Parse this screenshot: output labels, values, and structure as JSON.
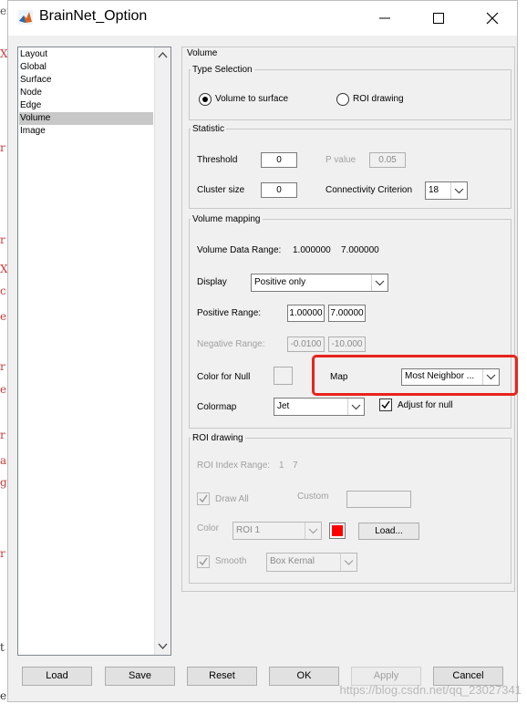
{
  "window": {
    "title": "BrainNet_Option"
  },
  "colors": {
    "highlight": "#e8241c",
    "roi_color": "#ff0000"
  },
  "background_fragments": [
    "ef",
    "X",
    "r",
    "r",
    "X",
    "c",
    "e",
    "r",
    "e",
    "r",
    "a",
    "g",
    "r",
    "t",
    "e."
  ],
  "sidebar": {
    "items": [
      "Layout",
      "Global",
      "Surface",
      "Node",
      "Edge",
      "Volume",
      "Image"
    ],
    "selected": "Volume"
  },
  "volume_panel": {
    "title": "Volume",
    "type_selection": {
      "title": "Type Selection",
      "options": [
        {
          "label": "Volume to surface",
          "selected": true
        },
        {
          "label": "ROI drawing",
          "selected": false
        }
      ]
    },
    "statistic": {
      "title": "Statistic",
      "threshold_label": "Threshold",
      "threshold_value": "0",
      "pvalue_label": "P value",
      "pvalue_value": "0.05",
      "cluster_label": "Cluster size",
      "cluster_value": "0",
      "connectivity_label": "Connectivity Criterion",
      "connectivity_value": "18"
    },
    "volume_mapping": {
      "title": "Volume mapping",
      "data_range_label": "Volume Data Range:",
      "data_range_min": "1.000000",
      "data_range_max": "7.000000",
      "display_label": "Display",
      "display_value": "Positive only",
      "positive_label": "Positive Range:",
      "positive_min": "1.00000",
      "positive_max": "7.00000",
      "negative_label": "Negative Range:",
      "negative_min": "-0.0100",
      "negative_max": "-10.000",
      "color_null_label": "Color for Null",
      "map_label": "Map",
      "map_value": "Most Neighbor ...",
      "colormap_label": "Colormap",
      "colormap_value": "Jet",
      "adjust_null_label": "Adjust for null",
      "adjust_null_checked": true
    },
    "roi_drawing": {
      "title": "ROI drawing",
      "index_range_label": "ROI Index Range:",
      "index_range_min": "1",
      "index_range_max": "7",
      "draw_all_label": "Draw All",
      "custom_label": "Custom",
      "color_label": "Color",
      "roi_select_value": "ROI 1",
      "load_label": "Load...",
      "smooth_label": "Smooth",
      "smooth_select_value": "Box Kernal"
    }
  },
  "footer": {
    "buttons": [
      "Load",
      "Save",
      "Reset",
      "OK",
      "Apply",
      "Cancel"
    ]
  },
  "watermark": "https://blog.csdn.net/qq_23027341"
}
